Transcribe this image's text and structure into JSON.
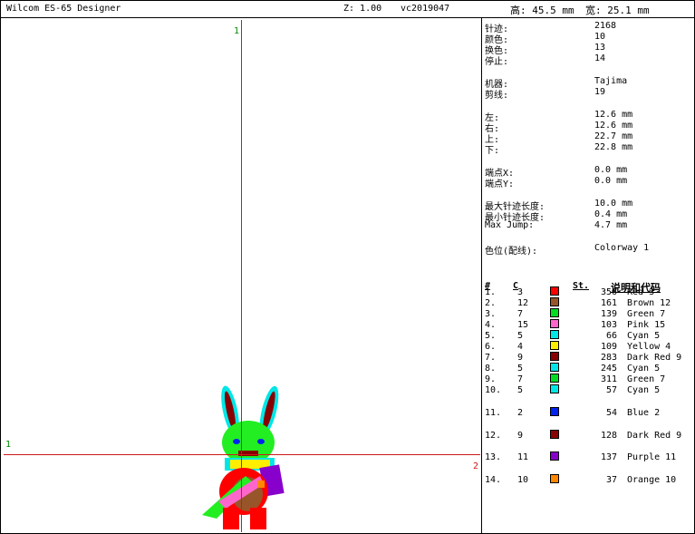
{
  "titlebar": {
    "app": "Wilcom ES-65 Designer",
    "zoom": "Z: 1.00",
    "file": "vc2019047",
    "height": "高: 45.5 mm",
    "width": "宽: 25.1 mm"
  },
  "canvas": {
    "axis_top": "1",
    "axis_left": "1",
    "axis_right": "2"
  },
  "info": [
    {
      "label": "针迹:",
      "value": "2168"
    },
    {
      "label": "颜色:",
      "value": "10"
    },
    {
      "label": "换色:",
      "value": "13"
    },
    {
      "label": "停止:",
      "value": "14"
    },
    {
      "label": "机器:",
      "value": "Tajima"
    },
    {
      "label": "剪线:",
      "value": "19"
    },
    {
      "label": "左:",
      "value": "12.6 mm"
    },
    {
      "label": "右:",
      "value": "12.6 mm"
    },
    {
      "label": "上:",
      "value": "22.7 mm"
    },
    {
      "label": "下:",
      "value": "22.8 mm"
    },
    {
      "label": "端点X:",
      "value": "0.0 mm"
    },
    {
      "label": "端点Y:",
      "value": "0.0 mm"
    },
    {
      "label": "最大针迹长度:",
      "value": "10.0 mm"
    },
    {
      "label": "最小针迹长度:",
      "value": "0.4 mm"
    },
    {
      "label": "Max Jump:",
      "value": "4.7 mm"
    },
    {
      "label": "色位(配线):",
      "value": "Colorway 1"
    }
  ],
  "table": {
    "headers": {
      "num": "#",
      "color": "C",
      "stitches": "St.",
      "desc": "说明和代码"
    },
    "rows": [
      {
        "n": "1.",
        "c": "3",
        "hex": "#ff0000",
        "st": "356",
        "name": "Red 3"
      },
      {
        "n": "2.",
        "c": "12",
        "hex": "#99552a",
        "st": "161",
        "name": "Brown 12"
      },
      {
        "n": "3.",
        "c": "7",
        "hex": "#00dd22",
        "st": "139",
        "name": "Green 7"
      },
      {
        "n": "4.",
        "c": "15",
        "hex": "#ff66cc",
        "st": "103",
        "name": "Pink 15"
      },
      {
        "n": "5.",
        "c": "5",
        "hex": "#00e6e6",
        "st": "66",
        "name": "Cyan 5"
      },
      {
        "n": "6.",
        "c": "4",
        "hex": "#ffee00",
        "st": "109",
        "name": "Yellow 4"
      },
      {
        "n": "7.",
        "c": "9",
        "hex": "#880000",
        "st": "283",
        "name": "Dark Red 9"
      },
      {
        "n": "8.",
        "c": "5",
        "hex": "#00e6e6",
        "st": "245",
        "name": "Cyan 5"
      },
      {
        "n": "9.",
        "c": "7",
        "hex": "#00dd22",
        "st": "311",
        "name": "Green 7"
      },
      {
        "n": "10.",
        "c": "5",
        "hex": "#00e6e6",
        "st": "57",
        "name": "Cyan 5"
      },
      {
        "n": "11.",
        "c": "2",
        "hex": "#0022ee",
        "st": "54",
        "name": "Blue 2"
      },
      {
        "n": "12.",
        "c": "9",
        "hex": "#880000",
        "st": "128",
        "name": "Dark Red 9"
      },
      {
        "n": "13.",
        "c": "11",
        "hex": "#8800cc",
        "st": "137",
        "name": "Purple 11"
      },
      {
        "n": "14.",
        "c": "10",
        "hex": "#ff8800",
        "st": "37",
        "name": "Orange 10"
      }
    ]
  }
}
